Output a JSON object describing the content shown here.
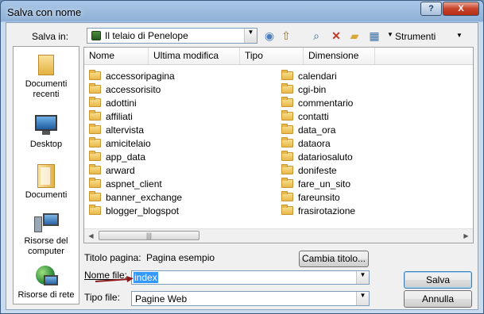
{
  "window": {
    "title": "Salva con nome"
  },
  "titlebar": {
    "help": "?",
    "close": "X"
  },
  "toolbar": {
    "salva_in_label": "Salva in:",
    "location": "Il telaio di Penelope",
    "strumenti_label": "Strumenti"
  },
  "places": [
    {
      "label": "Documenti recenti",
      "icon": "recent-documents-icon"
    },
    {
      "label": "Desktop",
      "icon": "desktop-icon"
    },
    {
      "label": "Documenti",
      "icon": "documents-icon"
    },
    {
      "label": "Risorse del computer",
      "icon": "computer-icon"
    },
    {
      "label": "Risorse di rete",
      "icon": "network-icon"
    }
  ],
  "columns": [
    "Nome",
    "Ultima modifica",
    "Tipo",
    "Dimensione"
  ],
  "files_left": [
    "accessoripagina",
    "accessorisito",
    "adottini",
    "affiliati",
    "altervista",
    "amicitelaio",
    "app_data",
    "arward",
    "aspnet_client",
    "banner_exchange",
    "blogger_blogspot"
  ],
  "files_right": [
    "calendari",
    "cgi-bin",
    "commentario",
    "contatti",
    "data_ora",
    "dataora",
    "datariosaluto",
    "donifeste",
    "fare_un_sito",
    "fareunsito",
    "frasirotazione"
  ],
  "form": {
    "titolo_pagina_label": "Titolo pagina:",
    "titolo_pagina_value": "Pagina esempio",
    "cambia_titolo": "Cambia titolo...",
    "nome_file_label": "Nome file:",
    "nome_file_value": "index",
    "tipo_file_label": "Tipo file:",
    "tipo_file_value": "Pagine Web",
    "salva": "Salva",
    "annulla": "Annulla"
  },
  "colors": {
    "folder": "#e8b84a",
    "selection": "#3399ff",
    "annotation_arrow": "#8b1a1a"
  }
}
